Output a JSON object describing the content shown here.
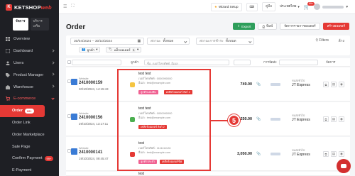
{
  "brand": {
    "name": "KETSHOP",
    "suffix": "web"
  },
  "sidebar": {
    "tabs": [
      {
        "label": "จัดการ"
      },
      {
        "label": "บริการเสริม"
      }
    ],
    "items": [
      {
        "label": "Overview"
      },
      {
        "label": "Dashboard"
      },
      {
        "label": "Users"
      },
      {
        "label": "Product Manager"
      },
      {
        "label": "Warehouse"
      },
      {
        "label": "E-commerce"
      }
    ],
    "subitems": [
      {
        "label": "Order",
        "badge": "99+"
      },
      {
        "label": "Order Link"
      },
      {
        "label": "Order Marketplace"
      },
      {
        "label": "Sale Page"
      },
      {
        "label": "Confirm Payment",
        "badge": "99+"
      },
      {
        "label": "E-Payment"
      }
    ]
  },
  "topbar": {
    "wizard": "Wizard Setup",
    "help": "คู่มือ",
    "language": "ประเทศไทย",
    "cart_badge": "99+"
  },
  "page": {
    "title": "Order"
  },
  "actions": {
    "export": "Export",
    "print": "พิมพ์",
    "manage": "จัดการรายการออเดอร์",
    "create": "สร้างออเดอร์"
  },
  "filters": {
    "date_range": "30/04/2024 -- 30/10/2024",
    "status_label": "สถานะ",
    "status_value": "ทั้งหมด",
    "payment_label": "สถานะการชำระ",
    "payment_value": "ทั้งหมด",
    "chip_group": "ลูกค้า",
    "chip_tag": "แท็กออเดอร์",
    "chip_count": "1",
    "filters_link": "Filters",
    "clear_link": "ล้าง"
  },
  "table": {
    "customer_col": "ลูกค้า",
    "customer_search_placeholder": "ชื่อ, เบอร์โทรศัพท์, อีเมล",
    "shipping_col": "การจัดส่ง",
    "action_col": "จัดการ"
  },
  "orders": [
    {
      "small": "Website",
      "number": "2410000159",
      "date": "30/10/2024, 14:15:43",
      "customer": "test test",
      "phone": "เบอร์โทรศัพท์ : 0000990000",
      "email": "อีเมล : test@example.com",
      "tags": [
        "ลูกค้าแบบคิพ",
        "เคลียร์ออเดอร์ ลิงก์ 2"
      ],
      "amount": "749.00",
      "ship_small": "ขนส่งทั่วไป",
      "carrier": "JT Express"
    },
    {
      "small": "Website",
      "number": "2410000156",
      "date": "29/10/2024, 13:17:11",
      "customer": "test test",
      "phone": "เบอร์โทรศัพท์ : 0000990000",
      "email": "อีเมล : test@example.com",
      "tags": [
        "เคลียร์ออเดอร์ ลิงก์ 2"
      ],
      "amount": "3,250.00",
      "ship_small": "ขนส่งทั่วไป",
      "carrier": "JT Express"
    },
    {
      "small": "Website",
      "number": "2410000141",
      "date": "19/10/2024, 09:45:47",
      "customer": "test",
      "phone": "เบอร์โทรศัพท์ : 1111111126",
      "email": "อีเมล : test@example.com",
      "tags": [
        "ลูกค้าประจำ",
        "เคลียร์ออเดอร์ชิฟ"
      ],
      "amount": "3,050.00",
      "ship_small": "ขนส่งทั่วไป",
      "carrier": "JT Express"
    }
  ],
  "next_customer": "test",
  "annotation": {
    "step": "5"
  },
  "colors": {
    "accent": "#e53935",
    "sidebar": "#1e1f24",
    "export": "#2e9e5b"
  }
}
